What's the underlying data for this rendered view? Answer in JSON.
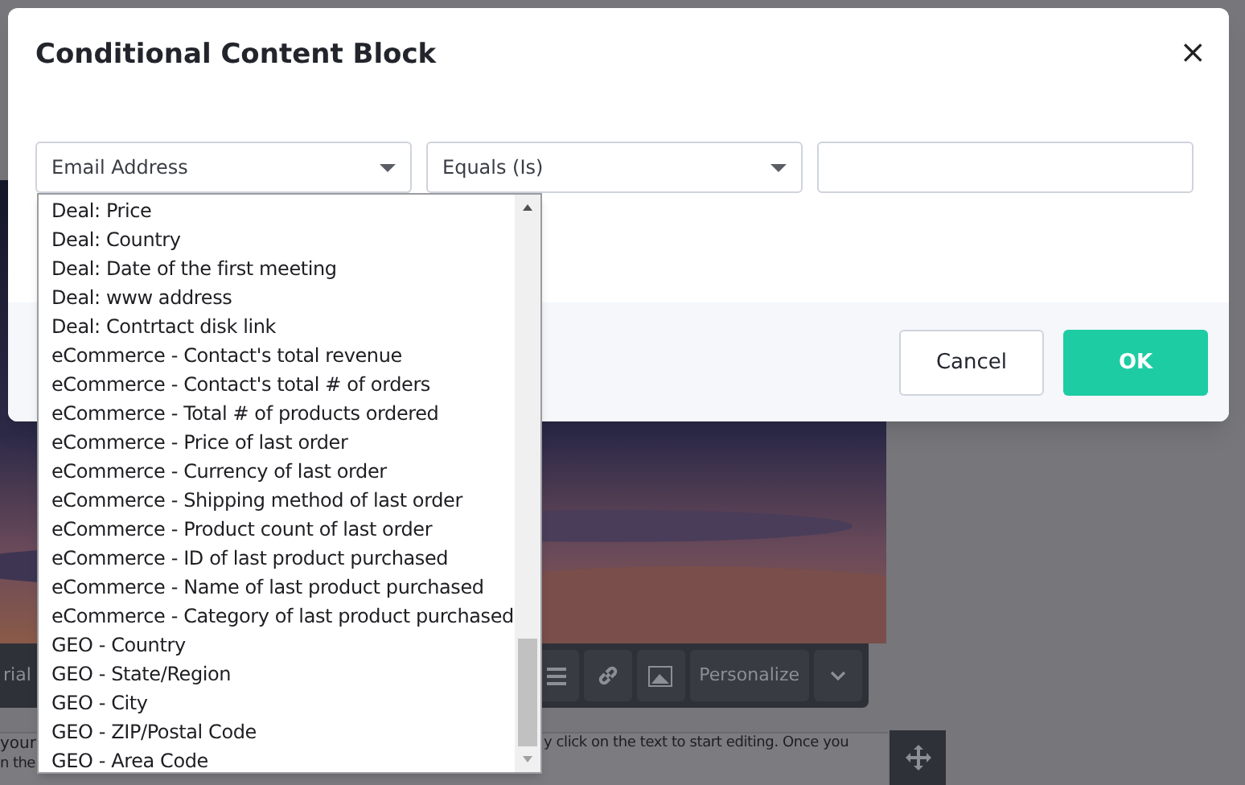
{
  "editor": {
    "font_select": "rial",
    "personalize_button": "Personalize",
    "text_fragments": [
      "your",
      "y click on the text to start editing. Once you",
      "n the"
    ]
  },
  "dialog": {
    "title": "Conditional Content Block",
    "close": "×",
    "field_select": {
      "value": "Email Address",
      "expanded": true
    },
    "operator_select": {
      "value": "Equals (Is)"
    },
    "buttons": [
      {
        "label": "Cancel",
        "kind": "secondary"
      },
      {
        "label": "OK",
        "kind": "primary"
      }
    ]
  },
  "dropdown": {
    "items": [
      "Deal: Price",
      "Deal: Country",
      "Deal: Date of the first meeting",
      "Deal: www address",
      "Deal: Contrtact disk link",
      "eCommerce - Contact's total revenue",
      "eCommerce - Contact's total # of orders",
      "eCommerce - Total # of products ordered",
      "eCommerce - Price of last order",
      "eCommerce - Currency of last order",
      "eCommerce - Shipping method of last order",
      "eCommerce - Product count of last order",
      "eCommerce - ID of last product purchased",
      "eCommerce - Name of last product purchased",
      "eCommerce - Category of last product purchased",
      "GEO - Country",
      "GEO - State/Region",
      "GEO - City",
      "GEO - ZIP/Postal Code",
      "GEO - Area Code"
    ]
  }
}
